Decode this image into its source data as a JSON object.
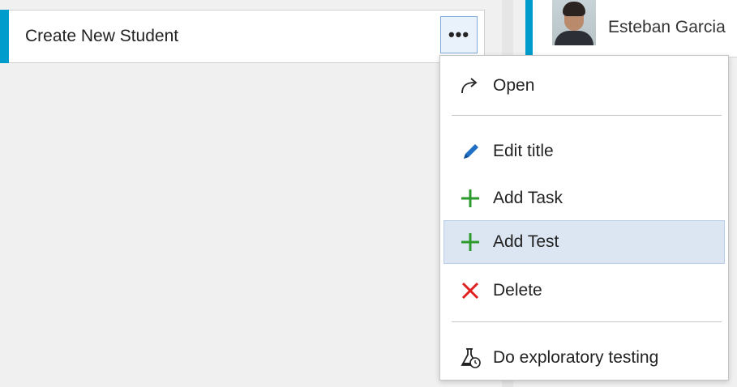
{
  "card": {
    "title": "Create New Student",
    "more_label": "•••",
    "accent_color": "#009ccc"
  },
  "assignee": {
    "name": "Esteban Garcia"
  },
  "context_menu": {
    "items": [
      {
        "label": "Open",
        "icon": "open-arrow-icon"
      },
      {
        "label": "Edit title",
        "icon": "pencil-icon",
        "icon_color": "#1f6fc5"
      },
      {
        "label": "Add Task",
        "icon": "plus-icon",
        "icon_color": "#2c9a2c"
      },
      {
        "label": "Add Test",
        "icon": "plus-icon",
        "icon_color": "#2c9a2c",
        "highlighted": true
      },
      {
        "label": "Delete",
        "icon": "x-icon",
        "icon_color": "#e01f1f"
      },
      {
        "label": "Do exploratory testing",
        "icon": "flask-icon"
      }
    ],
    "highlight_color": "#dce6f3"
  }
}
